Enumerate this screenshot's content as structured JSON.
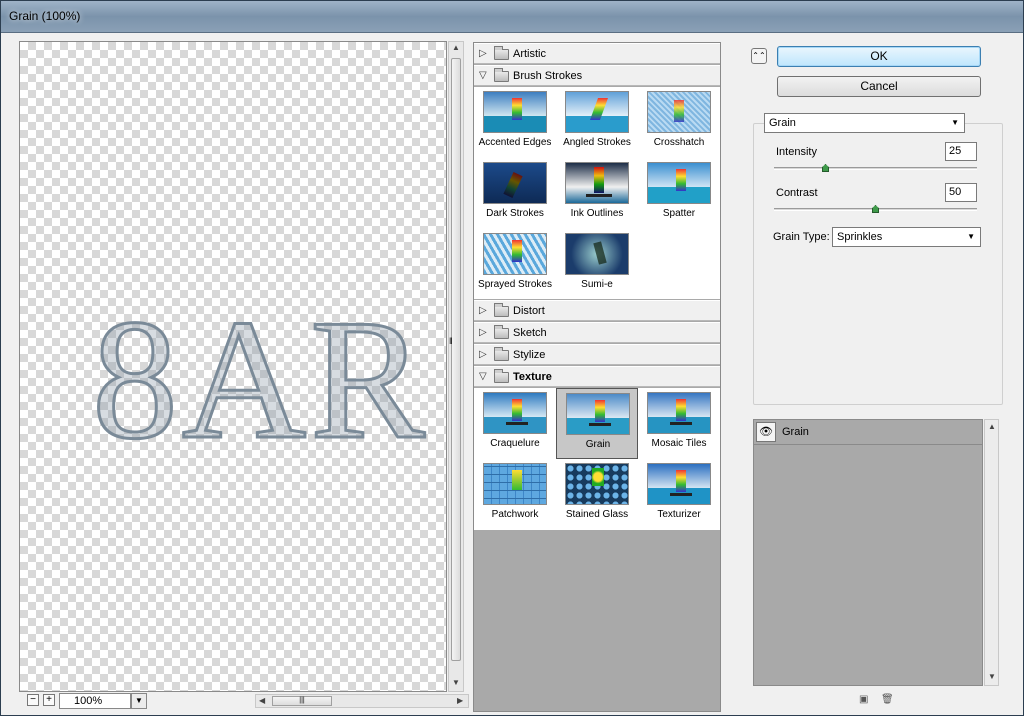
{
  "window": {
    "title": "Grain (100%)"
  },
  "preview": {
    "text": "8AR",
    "zoom": "100%"
  },
  "gallery": {
    "categories": [
      {
        "label": "Artistic"
      },
      {
        "label": "Brush Strokes"
      },
      {
        "label": "Distort"
      },
      {
        "label": "Sketch"
      },
      {
        "label": "Stylize"
      },
      {
        "label": "Texture"
      }
    ],
    "brush_strokes": [
      "Accented Edges",
      "Angled Strokes",
      "Crosshatch",
      "Dark Strokes",
      "Ink Outlines",
      "Spatter",
      "Sprayed Strokes",
      "Sumi-e"
    ],
    "texture": [
      "Craquelure",
      "Grain",
      "Mosaic Tiles",
      "Patchwork",
      "Stained Glass",
      "Texturizer"
    ],
    "selected": "Grain"
  },
  "buttons": {
    "ok": "OK",
    "cancel": "Cancel"
  },
  "settings": {
    "filter": "Grain",
    "intensity_label": "Intensity",
    "intensity_value": "25",
    "contrast_label": "Contrast",
    "contrast_value": "50",
    "grain_type_label": "Grain Type:",
    "grain_type_value": "Sprinkles"
  },
  "layers": {
    "name": "Grain"
  },
  "icons": {
    "collapse": "double-chevron-up-icon",
    "eye": "eye-icon",
    "new": "new-layer-icon",
    "delete": "trash-icon"
  }
}
